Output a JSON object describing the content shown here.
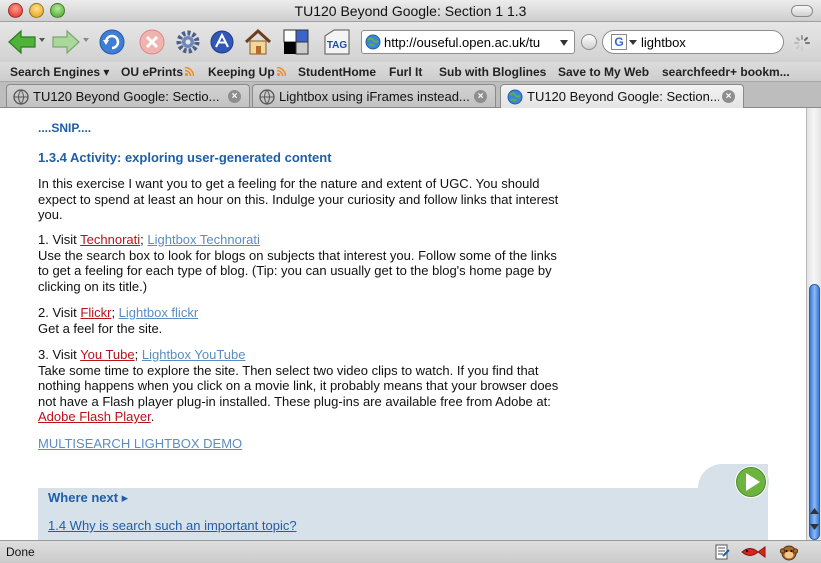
{
  "window": {
    "title": "TU120 Beyond Google: Section 1 1.3"
  },
  "toolbar": {
    "url": "http://ouseful.open.ac.uk/tu",
    "search_value": "lightbox",
    "search_engine_letter": "G",
    "tag_label": "TAG"
  },
  "bookmarks": [
    {
      "label": "Search Engines ▾"
    },
    {
      "label": "OU ePrints"
    },
    {
      "label": "Keeping Up"
    },
    {
      "label": "StudentHome"
    },
    {
      "label": "Furl It"
    },
    {
      "label": "Sub with Bloglines"
    },
    {
      "label": "Save to My Web"
    },
    {
      "label": "searchfeedr+ bookm..."
    }
  ],
  "tabs": [
    {
      "label": "TU120 Beyond Google: Sectio..."
    },
    {
      "label": "Lightbox using iFrames instead..."
    },
    {
      "label": "TU120 Beyond Google: Section..."
    }
  ],
  "content": {
    "snip": "....SNIP....",
    "heading": "1.3.4 Activity: exploring user-generated content",
    "intro_line1": "In this exercise I want you to get a feeling for the nature and extent of UGC. You should",
    "intro_line2": "expect to spend at least an hour on this. Indulge your curiosity and follow links that interest",
    "intro_line3": "you.",
    "step1": {
      "prefix": "1. Visit ",
      "link": "Technorati",
      "sep": "; ",
      "lightbox": "Lightbox Technorati",
      "line1": "Use the search box to look for blogs on subjects that interest you. Follow some of the links",
      "line2": "to get a feeling for each type of blog. (Tip: you can usually get to the blog's home page by",
      "line3": "clicking on its title.)"
    },
    "step2": {
      "prefix": "2. Visit ",
      "link": "Flickr",
      "sep": "; ",
      "lightbox": "Lightbox flickr",
      "line1": "Get a feel for the site."
    },
    "step3": {
      "prefix": "3. Visit ",
      "link": "You Tube",
      "sep": "; ",
      "lightbox": "Lightbox YouTube",
      "line1": "Take some time to explore the site. Then select two video clips to watch. If you find that",
      "line2": "nothing happens when you click on a movie link, it probably means that your browser does",
      "line3": "not have a Flash player plug-in installed. These plug-ins are available free from Adobe at:",
      "adobe_link": "Adobe Flash Player",
      "adobe_after": "."
    },
    "demo_link": "MULTISEARCH LIGHTBOX DEMO",
    "where_next": "Where next ▸",
    "next_link": "1.4 Why is search such an important topic?"
  },
  "status": {
    "text": "Done"
  },
  "colors": {
    "heading_blue": "#1f5ea8",
    "link_red": "#b8121b",
    "link_blue": "#5b8cc2",
    "panel": "#d6e1ea",
    "scroll_blue": "#3a78d6"
  }
}
